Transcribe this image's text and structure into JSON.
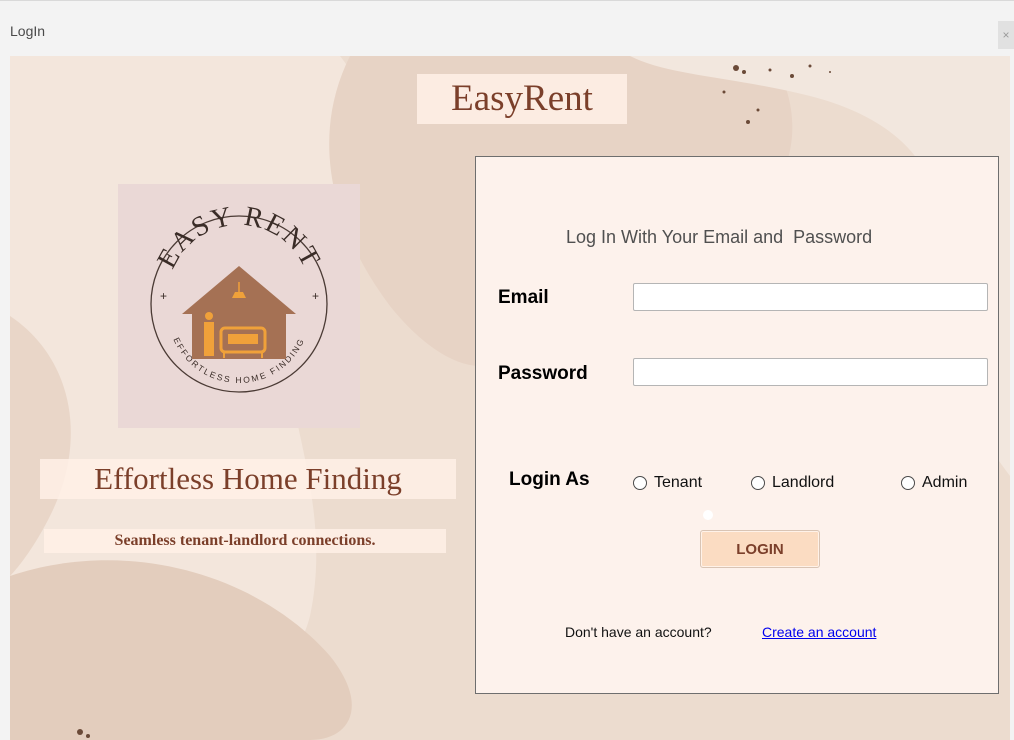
{
  "window": {
    "title": "LogIn",
    "close_label": "×"
  },
  "brand": {
    "name": "EasyRent",
    "logo_top_text": "EASY RENT",
    "logo_bottom_text": "EFFORTLESS HOME FINDING",
    "tagline": "Effortless Home Finding",
    "subtagline": "Seamless tenant-landlord connections."
  },
  "login_panel": {
    "heading": "Log In With Your Email and  Password",
    "email_label": "Email",
    "email_value": "",
    "password_label": "Password",
    "password_value": "",
    "login_as_label": "Login As",
    "roles": [
      {
        "label": "Tenant",
        "selected": false
      },
      {
        "label": "Landlord",
        "selected": false
      },
      {
        "label": "Admin",
        "selected": false
      }
    ],
    "login_button": "LOGIN",
    "no_account_text": "Don't have an account?",
    "create_account_link": "Create an account"
  },
  "colors": {
    "brand_brown": "#7b3f2a",
    "panel_bg": "#fdf2ec",
    "button_bg": "#fbdcc2",
    "logo_bg": "#ead8d6",
    "house_brown": "#a57154",
    "furniture_orange": "#f0a13a",
    "link_blue": "#0000ee"
  }
}
